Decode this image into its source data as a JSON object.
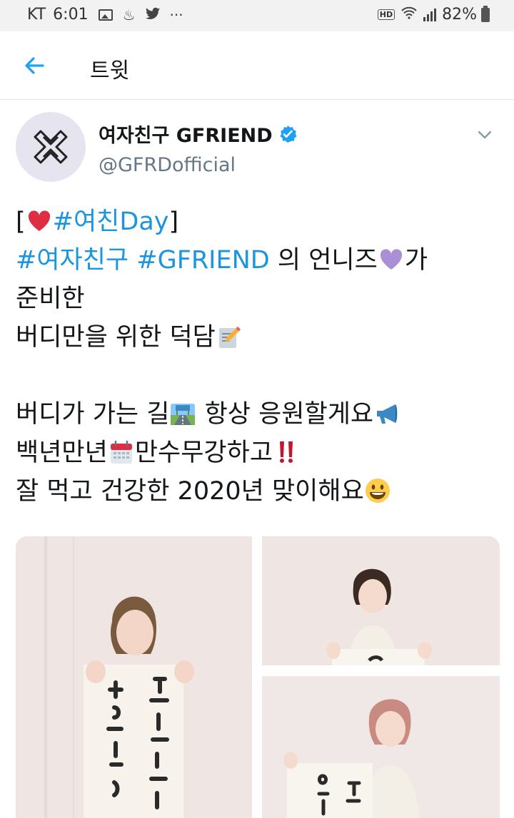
{
  "status_bar": {
    "carrier": "KT",
    "time": "6:01",
    "more": "···",
    "hd": "HD",
    "battery": "82%"
  },
  "header": {
    "title": "트윗"
  },
  "tweet": {
    "author_name": "여자친구 GFRIEND",
    "handle": "@GFRDofficial",
    "lines": [
      {
        "t1": "[",
        "h1": "#여친Day",
        "t2": "]"
      },
      {
        "h1": "#여자친구",
        "h2": "#GFRIEND",
        "t1": " 의 언니즈",
        "t2": "가"
      },
      {
        "t1": "준비한"
      },
      {
        "t1": "버디만을 위한 덕담"
      },
      {
        "t1": "버디가 가는 길",
        "t2": " 항상 응원할게요"
      },
      {
        "t1": "백년만년",
        "t2": "만수무강하고"
      },
      {
        "t1": "잘 먹고 건강한 2020년 맞이해요"
      }
    ],
    "emoji": {
      "heart_red": "red-heart",
      "heart_purple": "purple-heart",
      "memo": "memo",
      "road": "motorway",
      "megaphone": "megaphone",
      "calendar": "calendar",
      "exclamation": "double-exclamation",
      "smile": "grinning-face"
    }
  },
  "colors": {
    "link": "#1b95e0",
    "text": "#14171a",
    "muted": "#657786",
    "verified": "#1da1f2"
  }
}
